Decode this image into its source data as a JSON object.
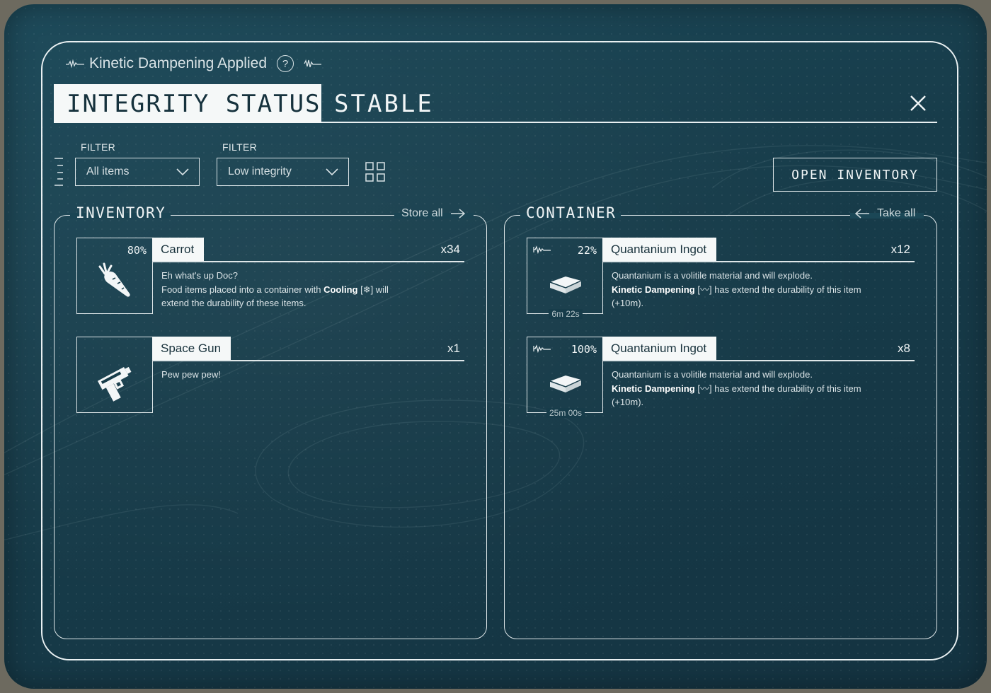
{
  "effect": {
    "label": "Kinetic Dampening Applied",
    "help": "?"
  },
  "header": {
    "title": "INTEGRITY STATUS",
    "value": "STABLE"
  },
  "filters": [
    {
      "label": "FILTER",
      "value": "All items"
    },
    {
      "label": "FILTER",
      "value": "Low integrity"
    }
  ],
  "open_inventory_label": "OPEN INVENTORY",
  "inventory": {
    "title": "INVENTORY",
    "action": "Store all",
    "items": [
      {
        "integrity": "80%",
        "name": "Carrot",
        "qty": "x34",
        "icon": "carrot-icon",
        "desc_line1": "Eh what's up Doc?",
        "desc_pre": "Food items placed into a container with ",
        "desc_bold": "Cooling",
        "desc_post": " [❄] will extend the durability of these items."
      },
      {
        "integrity": "",
        "name": "Space Gun",
        "qty": "x1",
        "icon": "space-gun-icon",
        "desc_line1": "Pew pew pew!"
      }
    ]
  },
  "container": {
    "title": "CONTAINER",
    "action": "Take all",
    "items": [
      {
        "integrity": "22%",
        "name": "Quantanium Ingot",
        "qty": "x12",
        "icon": "ingot-icon",
        "timer": "6m 22s",
        "desc_line1": "Quantanium is a volitile material and will explode.",
        "desc_bold": "Kinetic Dampening",
        "desc_post": " [〰] has extend the durability of this item (+10m)."
      },
      {
        "integrity": "100%",
        "name": "Quantanium Ingot",
        "qty": "x8",
        "icon": "ingot-icon",
        "timer": "25m 00s",
        "desc_line1": "Quantanium is a volitile material and will explode.",
        "desc_bold": "Kinetic Dampening",
        "desc_post": " [〰] has extend the durability of this item (+10m)."
      }
    ]
  },
  "colors": {
    "background": "#173c4a",
    "line": "#e9f0f2",
    "label_fill": "#f5f8f8"
  }
}
